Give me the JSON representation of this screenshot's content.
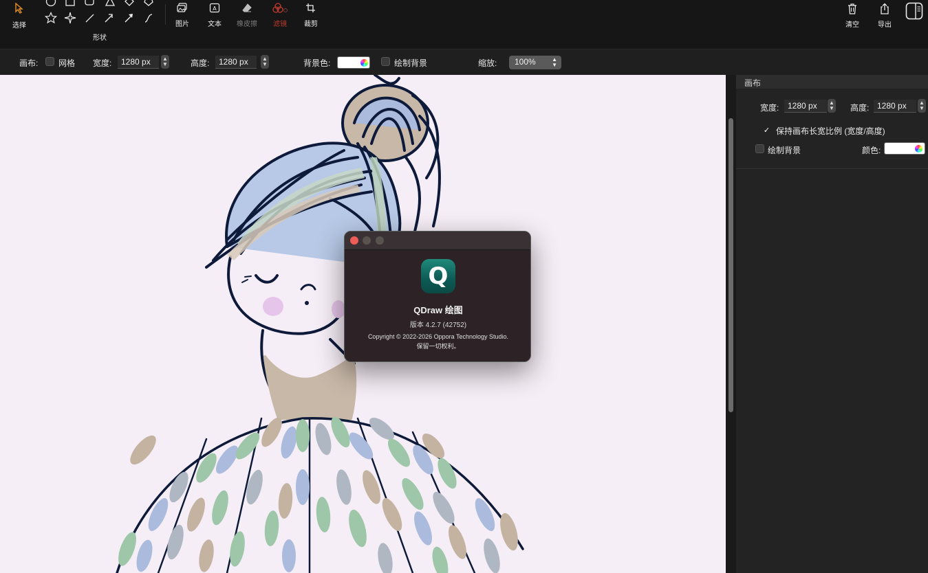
{
  "toolbar": {
    "select_label": "选择",
    "shapes_label": "形状",
    "image_label": "图片",
    "text_label": "文本",
    "eraser_label": "橡皮擦",
    "filter_label": "滤镜",
    "crop_label": "裁剪",
    "clear_label": "清空",
    "export_label": "导出"
  },
  "options": {
    "canvas_label": "画布:",
    "grid_label": "网格",
    "width_label": "宽度:",
    "width_value": "1280 px",
    "height_label": "高度:",
    "height_value": "1280 px",
    "bg_color_label": "背景色:",
    "draw_bg_label": "绘制背景",
    "zoom_label": "缩放:",
    "zoom_value": "100%"
  },
  "panel": {
    "header": "画布",
    "width_label": "宽度:",
    "width_value": "1280 px",
    "height_label": "高度:",
    "height_value": "1280 px",
    "keep_ratio_label": "保持画布长宽比例 (宽度/高度)",
    "draw_bg_label": "绘制背景",
    "color_label": "颜色:"
  },
  "about": {
    "app_name": "QDraw 绘图",
    "version": "版本 4.2.7 (42752)",
    "copyright": "Copyright © 2022-2026 Oppora Technology Studio.",
    "rights": "保留一切权利。",
    "icon_letter": "Q"
  },
  "colors": {
    "accent": "#e8901f",
    "canvas_bg": "#f6eef6",
    "icon_teal": "#0d5a54"
  }
}
